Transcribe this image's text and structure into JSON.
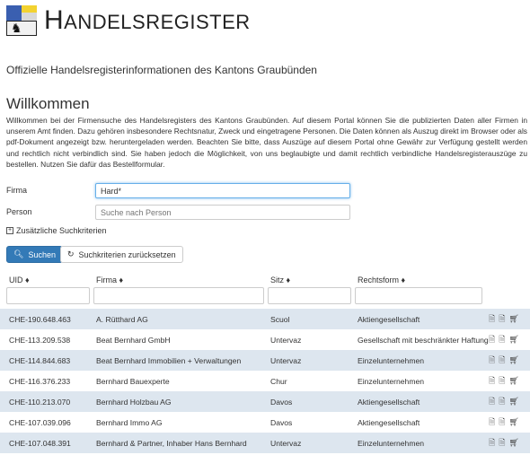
{
  "header": {
    "title_initial": "H",
    "title_rest": "ANDELSREGISTER"
  },
  "subtitle": "Offizielle Handelsregisterinformationen des Kantons Graubünden",
  "welcome": {
    "heading": "Willkommen",
    "text": "Willkommen bei der Firmensuche des Handelsregisters des Kantons Graubünden. Auf diesem Portal können Sie die publizierten Daten aller Firmen in unserem Amt finden. Dazu gehören insbesondere Rechtsnatur, Zweck und eingetragene Personen. Die Daten können als Auszug direkt im Browser oder als pdf-Dokument angezeigt bzw. heruntergeladen werden. Beachten Sie bitte, dass Auszüge auf diesem Portal ohne Gewähr zur Verfügung gestellt werden und rechtlich nicht verbindlich sind. Sie haben jedoch die Möglichkeit, von uns beglaubigte und damit rechtlich verbindliche Handelsregisterauszüge zu bestellen. Nutzen Sie dafür das Bestellformular."
  },
  "form": {
    "firma_label": "Firma",
    "firma_value": "Hard*",
    "person_label": "Person",
    "person_placeholder": "Suche nach Person",
    "more_criteria": "Zusätzliche Suchkriterien",
    "search_button": "Suchen",
    "reset_button": "Suchkriterien zurücksetzen"
  },
  "table": {
    "columns": [
      "UID ♦",
      "Firma ♦",
      "Sitz ♦",
      "Rechtsform ♦"
    ],
    "rows": [
      {
        "uid": "CHE-190.648.463",
        "firma": "A. Rütthard AG",
        "sitz": "Scuol",
        "rechtsform": "Aktiengesellschaft"
      },
      {
        "uid": "CHE-113.209.538",
        "firma": "Beat Bernhard GmbH",
        "sitz": "Untervaz",
        "rechtsform": "Gesellschaft mit beschränkter Haftung"
      },
      {
        "uid": "CHE-114.844.683",
        "firma": "Beat Bernhard Immobilien + Verwaltungen",
        "sitz": "Untervaz",
        "rechtsform": "Einzelunternehmen"
      },
      {
        "uid": "CHE-116.376.233",
        "firma": "Bernhard Bauexperte",
        "sitz": "Chur",
        "rechtsform": "Einzelunternehmen"
      },
      {
        "uid": "CHE-110.213.070",
        "firma": "Bernhard Holzbau AG",
        "sitz": "Davos",
        "rechtsform": "Aktiengesellschaft"
      },
      {
        "uid": "CHE-107.039.096",
        "firma": "Bernhard Immo AG",
        "sitz": "Davos",
        "rechtsform": "Aktiengesellschaft"
      },
      {
        "uid": "CHE-107.048.391",
        "firma": "Bernhard & Partner, Inhaber Hans Bernhard",
        "sitz": "Untervaz",
        "rechtsform": "Einzelunternehmen"
      }
    ],
    "action_icons": [
      "html-extract-icon",
      "pdf-extract-icon",
      "order-cart-icon"
    ]
  },
  "colors": {
    "primary": "#337ab7",
    "stripe": "#dde6ef"
  }
}
